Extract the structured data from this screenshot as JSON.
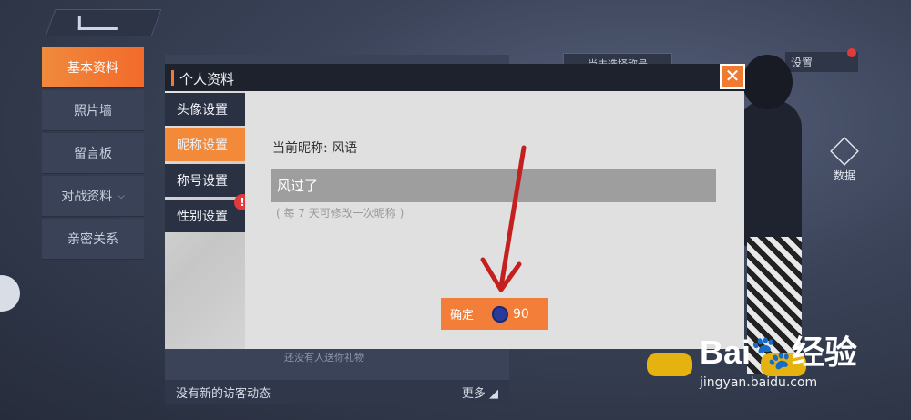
{
  "left_nav": {
    "items": [
      {
        "label": "基本资料",
        "active": true
      },
      {
        "label": "照片墙"
      },
      {
        "label": "留言板"
      },
      {
        "label": "对战资料",
        "has_dropdown": true
      },
      {
        "label": "亲密关系"
      }
    ]
  },
  "background": {
    "visitor_status": "没有新的访客动态",
    "more_label": "更多",
    "no_gift": "还没有人送你礼物",
    "title_select": "尚未选择称号",
    "settings_label": "设置",
    "data_label": "数据"
  },
  "dialog": {
    "title": "个人资料",
    "close_glyph": "✕",
    "sidebar": [
      {
        "label": "头像设置"
      },
      {
        "label": "昵称设置",
        "active": true
      },
      {
        "label": "称号设置"
      },
      {
        "label": "性别设置",
        "badge": "!"
      }
    ],
    "nickname": {
      "current_label": "当前昵称: 风语",
      "input_value": "风过了",
      "hint": "( 每 7 天可修改一次昵称 )",
      "confirm_label": "确定",
      "cost": "90"
    }
  },
  "watermark": {
    "logo": "Bai🐾经验",
    "url": "jingyan.baidu.com"
  },
  "colors": {
    "accent": "#f27e3a",
    "dark_panel": "#2a3142",
    "badge": "#e23a3a",
    "arrow": "#c42020"
  }
}
